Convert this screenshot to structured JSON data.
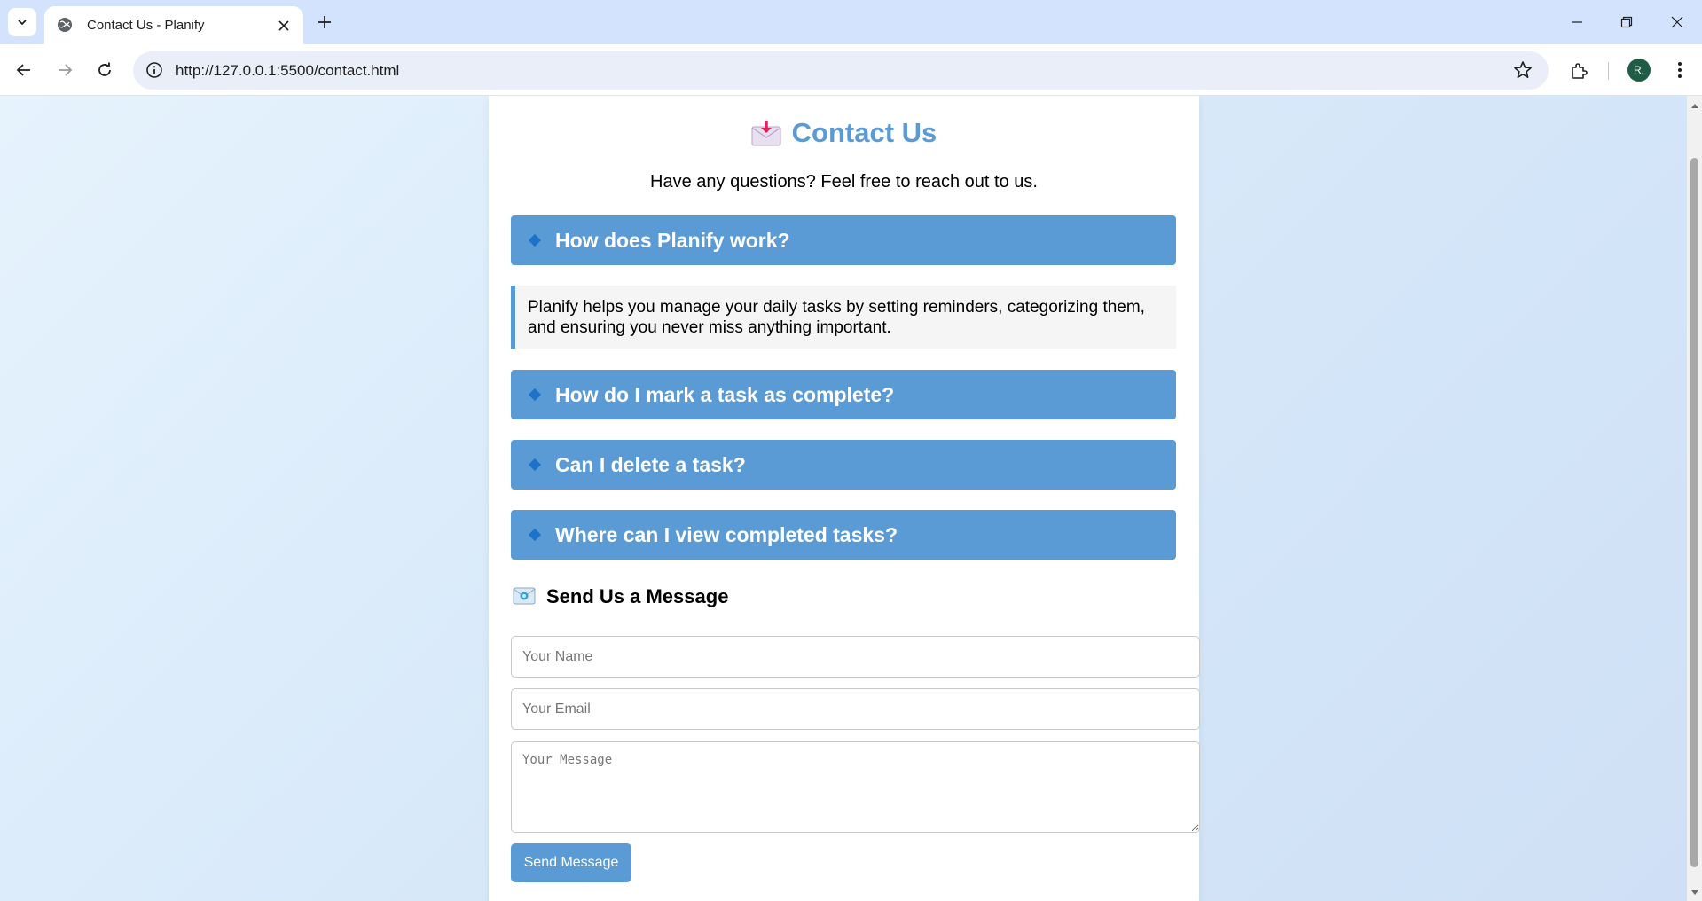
{
  "browser": {
    "tab_title": "Contact Us - Planify",
    "url": "http://127.0.0.1:5500/contact.html",
    "profile_initial": "R."
  },
  "page": {
    "title": "Contact Us",
    "subtitle": "Have any questions? Feel free to reach out to us.",
    "faqs": [
      {
        "question": "How does Planify work?",
        "expanded": true,
        "answer": "Planify helps you manage your daily tasks by setting reminders, categorizing them, and ensuring you never miss anything important."
      },
      {
        "question": "How do I mark a task as complete?",
        "expanded": false
      },
      {
        "question": "Can I delete a task?",
        "expanded": false
      },
      {
        "question": "Where can I view completed tasks?",
        "expanded": false
      }
    ],
    "message_section": {
      "heading": "Send Us a Message",
      "name_placeholder": "Your Name",
      "email_placeholder": "Your Email",
      "message_placeholder": "Your Message",
      "submit_label": "Send Message"
    }
  },
  "colors": {
    "accent": "#5b9bd5",
    "diamond": "#1a73c9",
    "chrome_tabstrip": "#d3e3fd"
  },
  "icons": {
    "title_icon": "envelope-with-arrow-icon",
    "message_icon": "envelope-icon"
  }
}
